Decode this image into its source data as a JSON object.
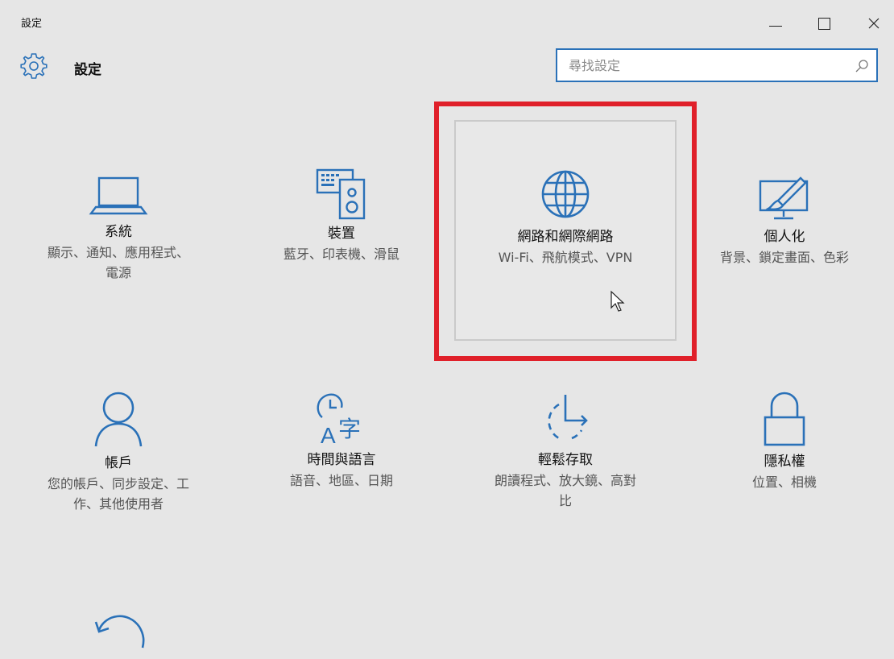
{
  "window": {
    "title": "設定",
    "controls": {
      "minimize": "minimize",
      "maximize": "maximize",
      "close": "close"
    }
  },
  "header": {
    "title": "設定",
    "search_placeholder": "尋找設定"
  },
  "accent_color": "#2a71b8",
  "highlight_color": "#e0202a",
  "tiles": [
    {
      "name": "系統",
      "desc": "顯示、通知、應用程式、電源",
      "icon": "laptop-icon"
    },
    {
      "name": "裝置",
      "desc": "藍牙、印表機、滑鼠",
      "icon": "devices-icon"
    },
    {
      "name": "網路和網際網路",
      "desc": "Wi-Fi、飛航模式、VPN",
      "icon": "globe-icon"
    },
    {
      "name": "個人化",
      "desc": "背景、鎖定畫面、色彩",
      "icon": "personalization-icon"
    },
    {
      "name": "帳戶",
      "desc": "您的帳戶、同步設定、工作、其他使用者",
      "icon": "person-icon"
    },
    {
      "name": "時間與語言",
      "desc": "語音、地區、日期",
      "icon": "time-language-icon"
    },
    {
      "name": "輕鬆存取",
      "desc": "朗讀程式、放大鏡、高對比",
      "icon": "ease-of-access-icon"
    },
    {
      "name": "隱私權",
      "desc": "位置、相機",
      "icon": "lock-icon"
    },
    {
      "name": "",
      "desc": "",
      "icon": "update-icon"
    }
  ]
}
